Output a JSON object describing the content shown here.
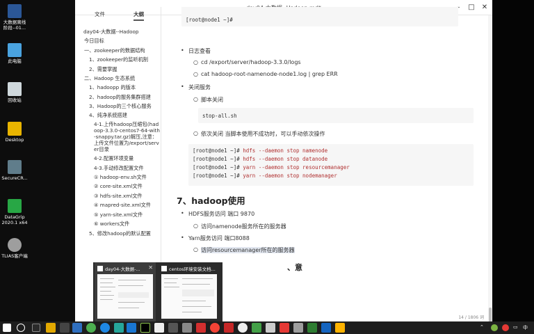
{
  "window": {
    "title": "day04-大数据--Hadoop.md*"
  },
  "desktop": {
    "icons": [
      {
        "label1": "大数据离线",
        "label2": "阶段--01...",
        "color": "#2b5797"
      },
      {
        "label1": "此电脑",
        "label2": "",
        "color": "#4aa3df"
      },
      {
        "label1": "回收站",
        "label2": "",
        "color": "#cfd8dc"
      },
      {
        "label1": "Desktop",
        "label2": "",
        "color": "#e8b400"
      },
      {
        "label1": "SecureCR...",
        "label2": "",
        "color": "#607d8b"
      },
      {
        "label1": "DataGrip",
        "label2": "2020.1 x64",
        "color": "#28a745"
      },
      {
        "label1": "TLIAS客户端",
        "label2": "",
        "color": "#9e9e9e"
      }
    ]
  },
  "sidebar": {
    "tab_files": "文件",
    "tab_outline": "大纲",
    "toc": [
      "day04-大数据--Hadoop",
      "今日目标",
      "一、zookeeper的数据结构",
      "1、zookeeper的监听机制",
      "2、需要掌握",
      "二、Hadoop 生态系统",
      "1、hadoopp 的版本",
      "2、hadoop的服务集群搭建",
      "3、Hadoop的三个核心服务",
      "4、纯净系统搭建",
      "4-1.上传hadoop压缩包(hadoop-3.3.0-centos7-64-with-snappy.tar.gz)解压,注意：上传文件位置为/export/server目录",
      "4-2.配置环境变量",
      "4-3.手动修改配置文件",
      "① hadoop-env.sh文件",
      "② core-site.xml文件",
      "③ hdfs-site.xml文件",
      "④ mapred-site.xml文件",
      "⑤ yarn-site.xml文件",
      "⑥ workers文件",
      "5、修改hadoop的默认配置"
    ]
  },
  "content": {
    "code_top_prompt": "[root@node1 ~]#",
    "log_title": "日志查看",
    "log_cd": "cd    /export/server/hadoop-3.3.0/logs",
    "log_cat": "cat hadoop-root-namenode-node1.log | grep ERR",
    "shutdown_title": "关闭服务",
    "script_shutdown": "脚本关闭",
    "stop_all": "stop-all.sh",
    "shutdown_each": "依次关闭  当脚本使用不成功时，可以手动依次操作",
    "cmd_prompt": "[root@node1 ~]#",
    "cmds": [
      "hdfs --daemon stop namenode",
      "hdfs --daemon stop datanode",
      "yarn --daemon stop resourcemanager",
      "yarn --daemon stop nodemanager"
    ],
    "section_title": "7、hadoop使用",
    "hdfs_access": "HDFS服务访问    端口 9870",
    "hdfs_visit": "访问namenode服务所在的服务器",
    "yarn_access": "Yarn服务访问    端口8088",
    "yarn_visit": "访问resourcemanager所在的服务器",
    "partial_heading": "、意",
    "word_count": "14 / 1806 词"
  },
  "popup": {
    "thumb1_title": "day04-大数据-...",
    "thumb2_title": "centos环境安装文档..."
  },
  "taskbar": {
    "tray_lang": "中",
    "tray_time": ""
  }
}
